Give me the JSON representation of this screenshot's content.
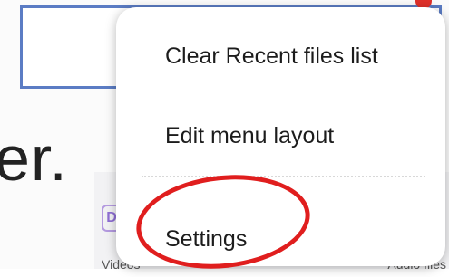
{
  "background": {
    "partial_text": "er.",
    "icon_letter": "D",
    "caption_left": "Videos",
    "caption_right": "Audio files"
  },
  "menu": {
    "items": [
      {
        "label": "Clear Recent files list"
      },
      {
        "label": "Edit menu layout"
      },
      {
        "label": "Settings"
      }
    ]
  },
  "colors": {
    "annotation_box": "#5b7cc4",
    "highlight_circle": "#e01e1e",
    "accent_icon": "#8f6fd4"
  },
  "icons": [
    "document-icon"
  ]
}
